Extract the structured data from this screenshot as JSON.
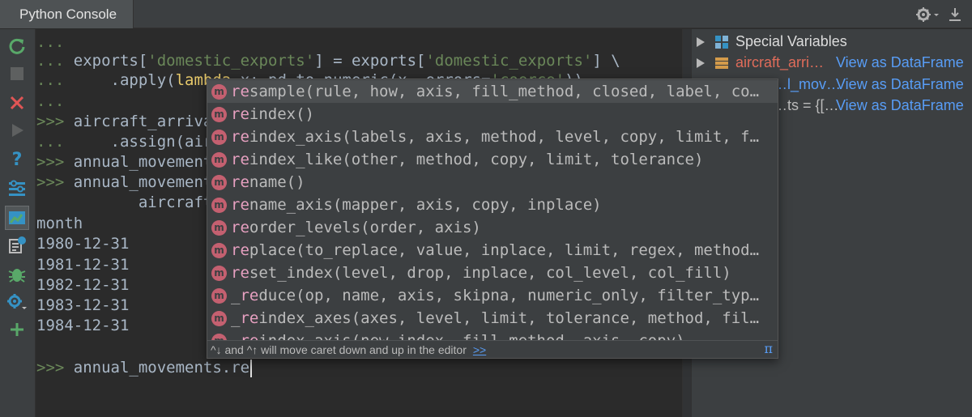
{
  "window": {
    "title": "Python Console"
  },
  "toolbar": {
    "buttons": [
      "rerun-icon",
      "stop-icon",
      "close-icon",
      "run-icon",
      "help-icon",
      "settings-list-icon",
      "show-variables-icon",
      "history-icon",
      "debug-icon",
      "gear-icon",
      "add-icon"
    ]
  },
  "console": {
    "lines": [
      {
        "prompt": "...",
        "code": ""
      },
      {
        "prompt": "...",
        "code_a": " exports[",
        "str_a": "'domestic_exports'",
        "code_b": "] = exports[",
        "str_b": "'domestic_exports'",
        "code_c": "] \\"
      },
      {
        "prompt": "...",
        "code_a": "     .apply(",
        "kw": "lambda",
        "code_b": " x: pd.to_numeric(x, errors=",
        "str_a": "'coerce'",
        "code_c": "))"
      },
      {
        "prompt": "...",
        "code": ""
      },
      {
        "prompt": ">>>",
        "code": " aircraft_arrivals = ..."
      },
      {
        "prompt": "...",
        "code": "     .assign(aircraft..."
      },
      {
        "prompt": ">>>",
        "code": " annual_movements = ..."
      },
      {
        "prompt": ">>>",
        "code": " annual_movements..."
      },
      {
        "prompt": "",
        "code": "           aircraft..."
      }
    ],
    "output": [
      "month",
      "1980-12-31",
      "1981-12-31",
      "1982-12-31",
      "1983-12-31",
      "1984-12-31"
    ],
    "input_prompt": ">>>",
    "input_value": " annual_movements.re"
  },
  "variables": {
    "items": [
      {
        "name": "Special Variables",
        "link": ""
      },
      {
        "name": "aircraft_arri…",
        "link": "View as DataFrame"
      },
      {
        "name": "…l_mov…",
        "link": "View as DataFrame"
      },
      {
        "name": "…ts = {[…",
        "link": "View as DataFrame"
      }
    ]
  },
  "autocomplete": {
    "items": [
      {
        "match": "re",
        "rest": "sample(rule, how, axis, fill_method, closed, label, co…"
      },
      {
        "match": "re",
        "rest": "index()"
      },
      {
        "match": "re",
        "rest": "index_axis(labels, axis, method, level, copy, limit, f…"
      },
      {
        "match": "re",
        "rest": "index_like(other, method, copy, limit, tolerance)"
      },
      {
        "match": "re",
        "rest": "name()"
      },
      {
        "match": "re",
        "rest": "name_axis(mapper, axis, copy, inplace)"
      },
      {
        "match": "re",
        "rest": "order_levels(order, axis)"
      },
      {
        "match": "re",
        "rest": "place(to_replace, value, inplace, limit, regex, method…"
      },
      {
        "match": "re",
        "rest": "set_index(level, drop, inplace, col_level, col_fill)"
      },
      {
        "pre": "_",
        "match": "re",
        "rest": "duce(op, name, axis, skipna, numeric_only, filter_typ…"
      },
      {
        "pre": "_",
        "match": "re",
        "rest": "index_axes(axes, level, limit, tolerance, method, fil…"
      },
      {
        "pre": "_",
        "match": "re",
        "rest": "index_axis(new_index, fill_method, axis, copy)"
      }
    ],
    "footer_text": "^↓ and ^↑ will move caret down and up in the editor",
    "footer_link": ">>",
    "footer_pi": "π",
    "kind_label": "m"
  }
}
